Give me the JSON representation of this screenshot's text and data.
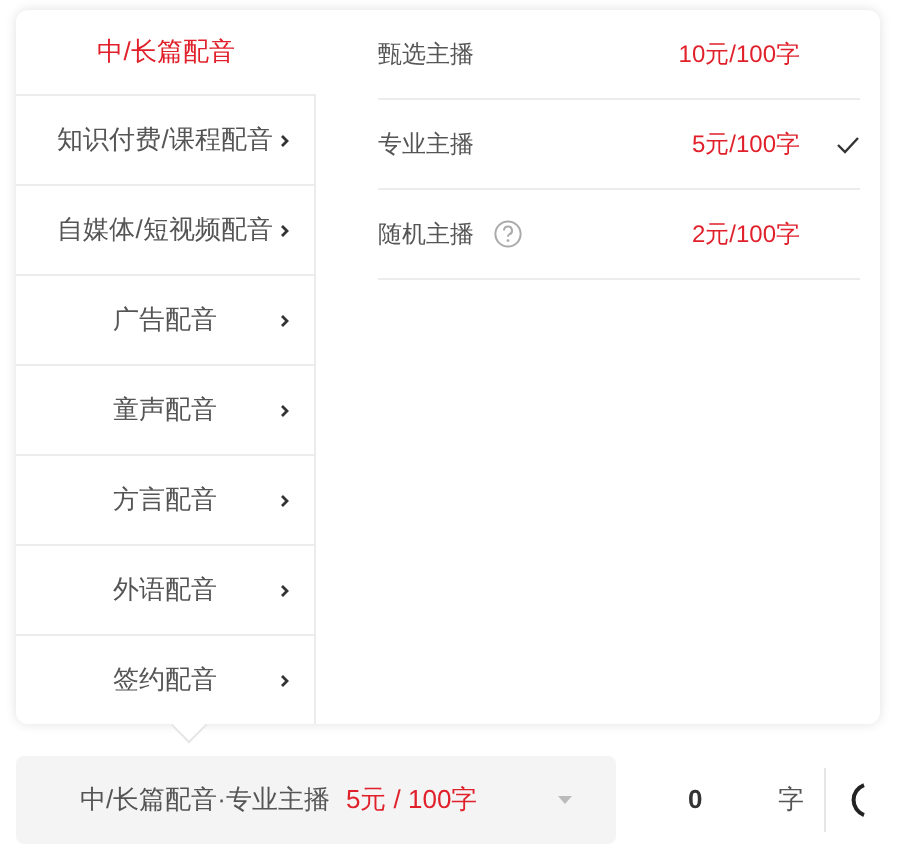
{
  "categories": [
    {
      "label": "中/长篇配音",
      "selected": true
    },
    {
      "label": "知识付费/课程配音",
      "selected": false
    },
    {
      "label": "自媒体/短视频配音",
      "selected": false
    },
    {
      "label": "广告配音",
      "selected": false
    },
    {
      "label": "童声配音",
      "selected": false
    },
    {
      "label": "方言配音",
      "selected": false
    },
    {
      "label": "外语配音",
      "selected": false
    },
    {
      "label": "签约配音",
      "selected": false
    }
  ],
  "anchors": [
    {
      "name": "甄选主播",
      "price": "10元/100字",
      "selected": false,
      "help": false
    },
    {
      "name": "专业主播",
      "price": "5元/100字",
      "selected": true,
      "help": false
    },
    {
      "name": "随机主播",
      "price": "2元/100字",
      "selected": false,
      "help": true
    }
  ],
  "selector": {
    "value": "中/长篇配音·专业主播",
    "price": "5元 / 100字"
  },
  "count": {
    "value": "0",
    "unit": "字"
  }
}
